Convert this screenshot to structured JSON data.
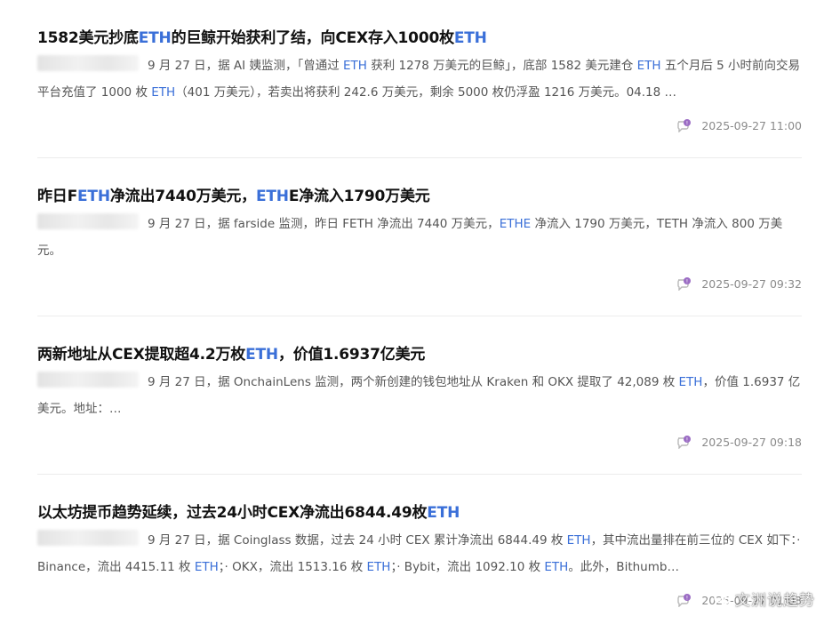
{
  "items": [
    {
      "title_parts": [
        "1582美元抄底",
        "ETH",
        "的巨鲸开始获利了结，向CEX存入1000枚",
        "ETH",
        ""
      ],
      "excerpt_parts": [
        "9 月 27 日，据 AI 姨监测，「曾通过 ",
        "ETH",
        " 获利 1278 万美元的巨鲸」，底部 1582 美元建仓 ",
        "ETH",
        " 五个月后 5 小时前向交易平台充值了 1000 枚 ",
        "ETH",
        "（401 万美元），若卖出将获利 242.6 万美元，剩余 5000 枚仍浮盈 1216 万美元。04.18 …"
      ],
      "time": "2025-09-27 11:00"
    },
    {
      "title_parts": [
        "昨日F",
        "ETH",
        "净流出7440万美元，",
        "ETH",
        "E净流入1790万美元"
      ],
      "excerpt_parts": [
        "9 月 27 日，据 farside 监测，昨日 FETH 净流出 7440 万美元，",
        "ETHE",
        " 净流入 1790 万美元，TETH 净流入 800 万美元。",
        "",
        ""
      ],
      "time": "2025-09-27 09:32"
    },
    {
      "title_parts": [
        "两新地址从CEX提取超4.2万枚",
        "ETH",
        "，价值1.6937亿美元",
        "",
        ""
      ],
      "excerpt_parts": [
        "9 月 27 日，据 OnchainLens 监测，两个新创建的钱包地址从 Kraken 和 OKX 提取了 42,089 枚 ",
        "ETH",
        "，价值 1.6937 亿美元。地址：…",
        "",
        ""
      ],
      "time": "2025-09-27 09:18"
    },
    {
      "title_parts": [
        "以太坊提币趋势延续，过去24小时CEX净流出6844.49枚",
        "ETH",
        "",
        "",
        ""
      ],
      "excerpt_parts": [
        "9 月 27 日，据 Coinglass 数据，过去 24 小时 CEX 累计净流出 6844.49 枚 ",
        "ETH",
        "，其中流出量排在前三位的 CEX 如下：· Binance，流出 4415.11 枚 ",
        "ETH",
        "；· OKX，流出 1513.16 枚 ",
        "ETH",
        "；· Bybit，流出 1092.10 枚 ",
        "ETH",
        "。此外，Bithumb…"
      ],
      "time": "2025-09-27 01:08"
    }
  ],
  "watermark": "文洲说趋势",
  "colors": {
    "highlight": "#3a6fd8",
    "title": "#111111",
    "meta": "#8a8a8a",
    "icon": "#9b6cc4"
  }
}
